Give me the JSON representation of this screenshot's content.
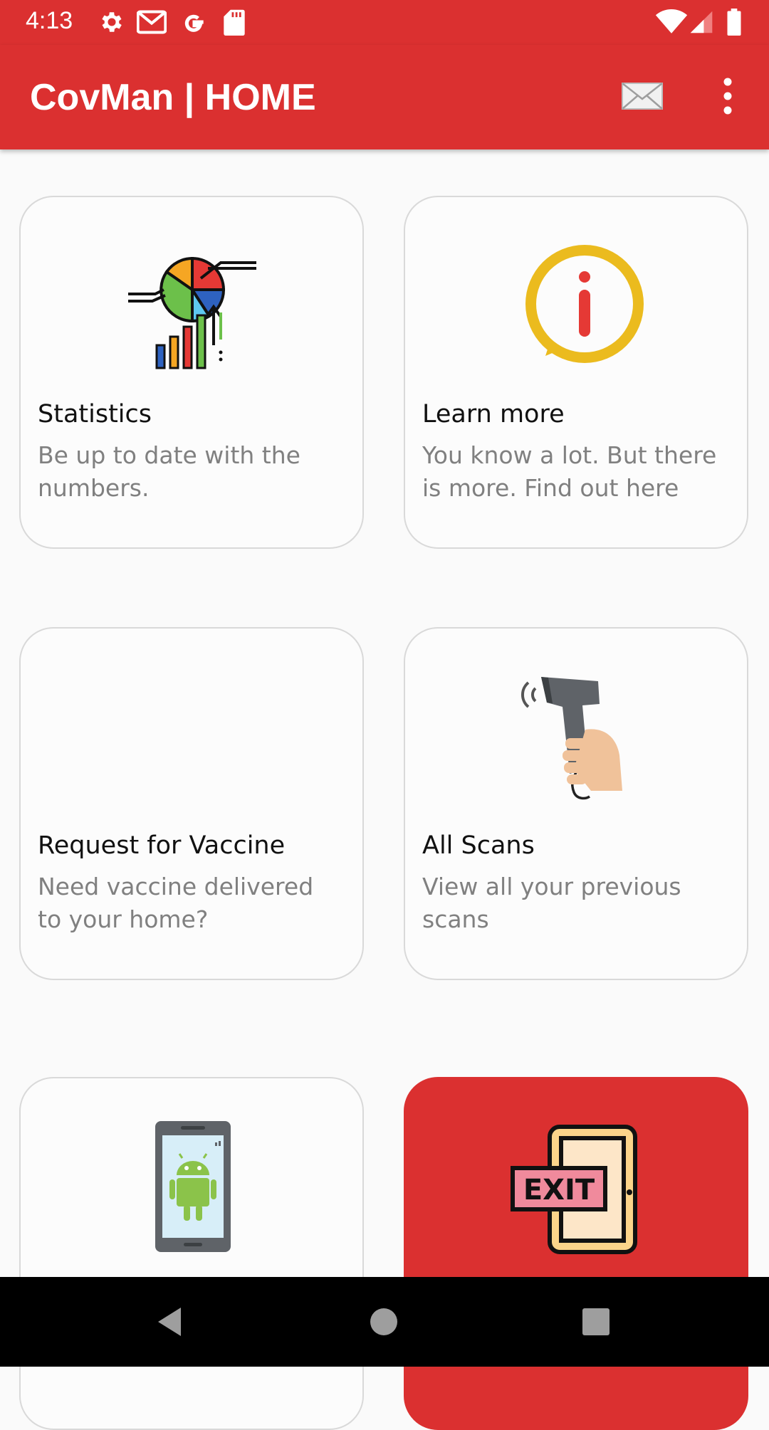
{
  "status_bar": {
    "time": "4:13",
    "icons": [
      "settings-icon",
      "gmail-icon",
      "google-icon",
      "sd-card-icon",
      "wifi-icon",
      "signal-icon",
      "battery-icon"
    ]
  },
  "app_bar": {
    "title": "CovMan | HOME",
    "actions": [
      "mail-icon",
      "more-vert-icon"
    ]
  },
  "cards": [
    {
      "title": "Statistics",
      "description": "Be up to date with the numbers.",
      "icon": "statistics-chart-icon"
    },
    {
      "title": "Learn more",
      "description": "You know a lot. But there is more. Find out here",
      "icon": "info-bubble-icon"
    },
    {
      "title": "Request for Vaccine",
      "description": "Need vaccine delivered to your home?",
      "icon": ""
    },
    {
      "title": "All Scans",
      "description": "View all your previous scans",
      "icon": "barcode-scanner-icon"
    },
    {
      "title": "",
      "description": "",
      "icon": "android-phone-icon"
    },
    {
      "title": "",
      "description": "",
      "icon": "exit-door-icon"
    }
  ],
  "nav_bar": {
    "buttons": [
      "back-icon",
      "home-icon",
      "recents-icon"
    ]
  },
  "colors": {
    "primary": "#db3030",
    "card_border": "#d9d9d9",
    "info_yellow": "#ebbb1e",
    "background": "#fafafa"
  }
}
